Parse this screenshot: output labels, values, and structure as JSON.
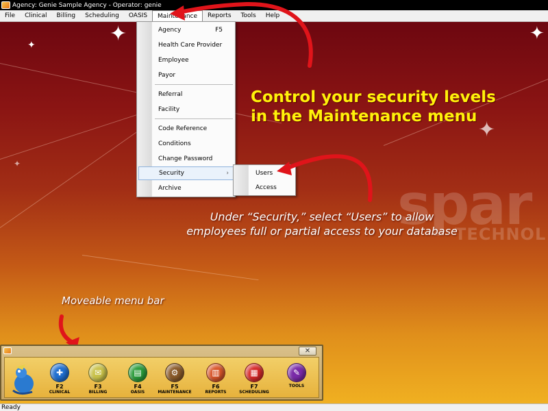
{
  "window": {
    "title": "Agency: Genie Sample Agency - Operator: genie"
  },
  "menubar": [
    {
      "id": "file",
      "label": "File"
    },
    {
      "id": "clinical",
      "label": "Clinical"
    },
    {
      "id": "billing",
      "label": "Billing"
    },
    {
      "id": "scheduling",
      "label": "Scheduling"
    },
    {
      "id": "oasis",
      "label": "OASIS"
    },
    {
      "id": "maintenance",
      "label": "Maintenance"
    },
    {
      "id": "reports",
      "label": "Reports"
    },
    {
      "id": "tools",
      "label": "Tools"
    },
    {
      "id": "help",
      "label": "Help"
    }
  ],
  "maintenance_menu": {
    "agency": {
      "label": "Agency",
      "shortcut": "F5"
    },
    "health_care_provider": {
      "label": "Health Care Provider"
    },
    "employee": {
      "label": "Employee"
    },
    "payor": {
      "label": "Payor"
    },
    "referral": {
      "label": "Referral"
    },
    "facility": {
      "label": "Facility"
    },
    "code_reference": {
      "label": "Code Reference"
    },
    "conditions": {
      "label": "Conditions"
    },
    "change_password": {
      "label": "Change Password"
    },
    "security": {
      "label": "Security",
      "submenu_arrow": "›"
    },
    "archive": {
      "label": "Archive"
    }
  },
  "security_submenu": {
    "users": {
      "label": "Users"
    },
    "access": {
      "label": "Access"
    }
  },
  "annotations": {
    "heading_line1": "Control your security levels",
    "heading_line2": "in the Maintenance menu",
    "security_line1": "Under “Security,” select “Users” to allow",
    "security_line2": "employees full or partial access to your database",
    "moveable": "Moveable menu bar"
  },
  "watermark": {
    "main": "spar",
    "sub": "TECHNOL"
  },
  "toolbar": {
    "close_glyph": "✕",
    "buttons": [
      {
        "key": "F2",
        "label": "CLINICAL",
        "color": "#1f6fd0",
        "glyph": "✚"
      },
      {
        "key": "F3",
        "label": "BILLING",
        "color": "#c9c24a",
        "glyph": "✉"
      },
      {
        "key": "F4",
        "label": "OASIS",
        "color": "#2a9c3a",
        "glyph": "▤"
      },
      {
        "key": "F5",
        "label": "MAINTENANCE",
        "color": "#8a5a2a",
        "glyph": "⚙"
      },
      {
        "key": "F6",
        "label": "REPORTS",
        "color": "#d8552a",
        "glyph": "▥"
      },
      {
        "key": "F7",
        "label": "SCHEDULING",
        "color": "#d62a2a",
        "glyph": "▦"
      },
      {
        "key": "",
        "label": "TOOLS",
        "color": "#7a2aa8",
        "glyph": "✎"
      }
    ]
  },
  "status": {
    "text": "Ready"
  },
  "colors": {
    "heading": "#fff20a",
    "arrow": "#e0141a"
  }
}
